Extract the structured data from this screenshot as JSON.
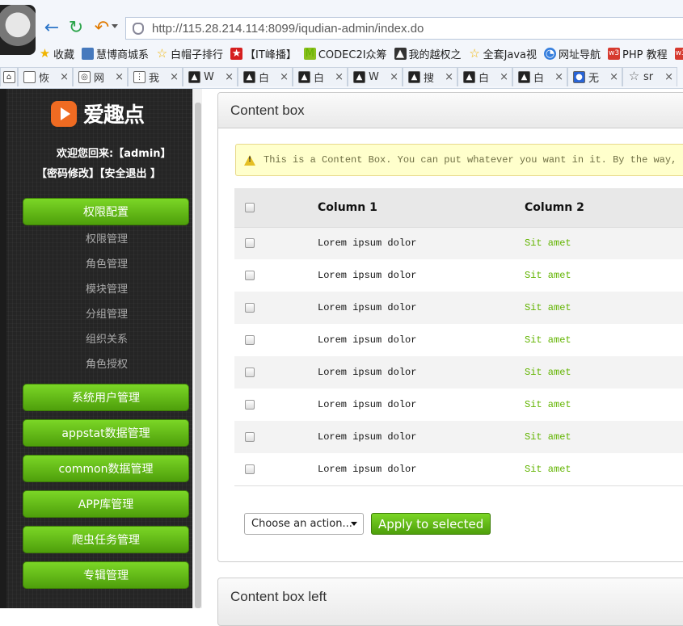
{
  "browser": {
    "url": "http://115.28.214.114:8099/iqudian-admin/index.do",
    "bookmarks": [
      "收藏",
      "慧博商城系",
      "白帽子排行",
      "【IT峰播】",
      "CODEC2I众筹",
      "我的越权之",
      "全套Java视",
      "网址导航",
      "PHP 教程",
      "w3"
    ],
    "tabs": [
      "",
      "恢",
      "网",
      "我",
      "W",
      "白",
      "白",
      "W",
      "搜",
      "白",
      "白",
      "无",
      "sr"
    ]
  },
  "sidebar": {
    "brand": "爱趣点",
    "welcome": "欢迎您回来:【admin】",
    "account_links": "【密码修改】【安全退出 】",
    "menus": [
      {
        "label": "权限配置"
      },
      {
        "label": "系统用户管理"
      },
      {
        "label": "appstat数据管理"
      },
      {
        "label": "common数据管理"
      },
      {
        "label": "APP库管理"
      },
      {
        "label": "爬虫任务管理"
      },
      {
        "label": "专辑管理"
      }
    ],
    "submenu": [
      "权限管理",
      "角色管理",
      "模块管理",
      "分组管理",
      "组织关系",
      "角色授权"
    ]
  },
  "content_box": {
    "title": "Content box",
    "notice": "This is a Content Box. You can put whatever you want in it. By the way, yo",
    "columns": [
      "Column 1",
      "Column 2"
    ],
    "rows": [
      {
        "col1": "Lorem ipsum dolor",
        "col2": "Sit amet"
      },
      {
        "col1": "Lorem ipsum dolor",
        "col2": "Sit amet"
      },
      {
        "col1": "Lorem ipsum dolor",
        "col2": "Sit amet"
      },
      {
        "col1": "Lorem ipsum dolor",
        "col2": "Sit amet"
      },
      {
        "col1": "Lorem ipsum dolor",
        "col2": "Sit amet"
      },
      {
        "col1": "Lorem ipsum dolor",
        "col2": "Sit amet"
      },
      {
        "col1": "Lorem ipsum dolor",
        "col2": "Sit amet"
      },
      {
        "col1": "Lorem ipsum dolor",
        "col2": "Sit amet"
      }
    ],
    "action_select": "Choose an action...",
    "apply_button": "Apply to selected"
  },
  "second_box": {
    "title": "Content box left"
  },
  "colors": {
    "accent_green": "#62b400",
    "sidebar_bg": "#252525",
    "link_blue": "#2d76c9"
  }
}
